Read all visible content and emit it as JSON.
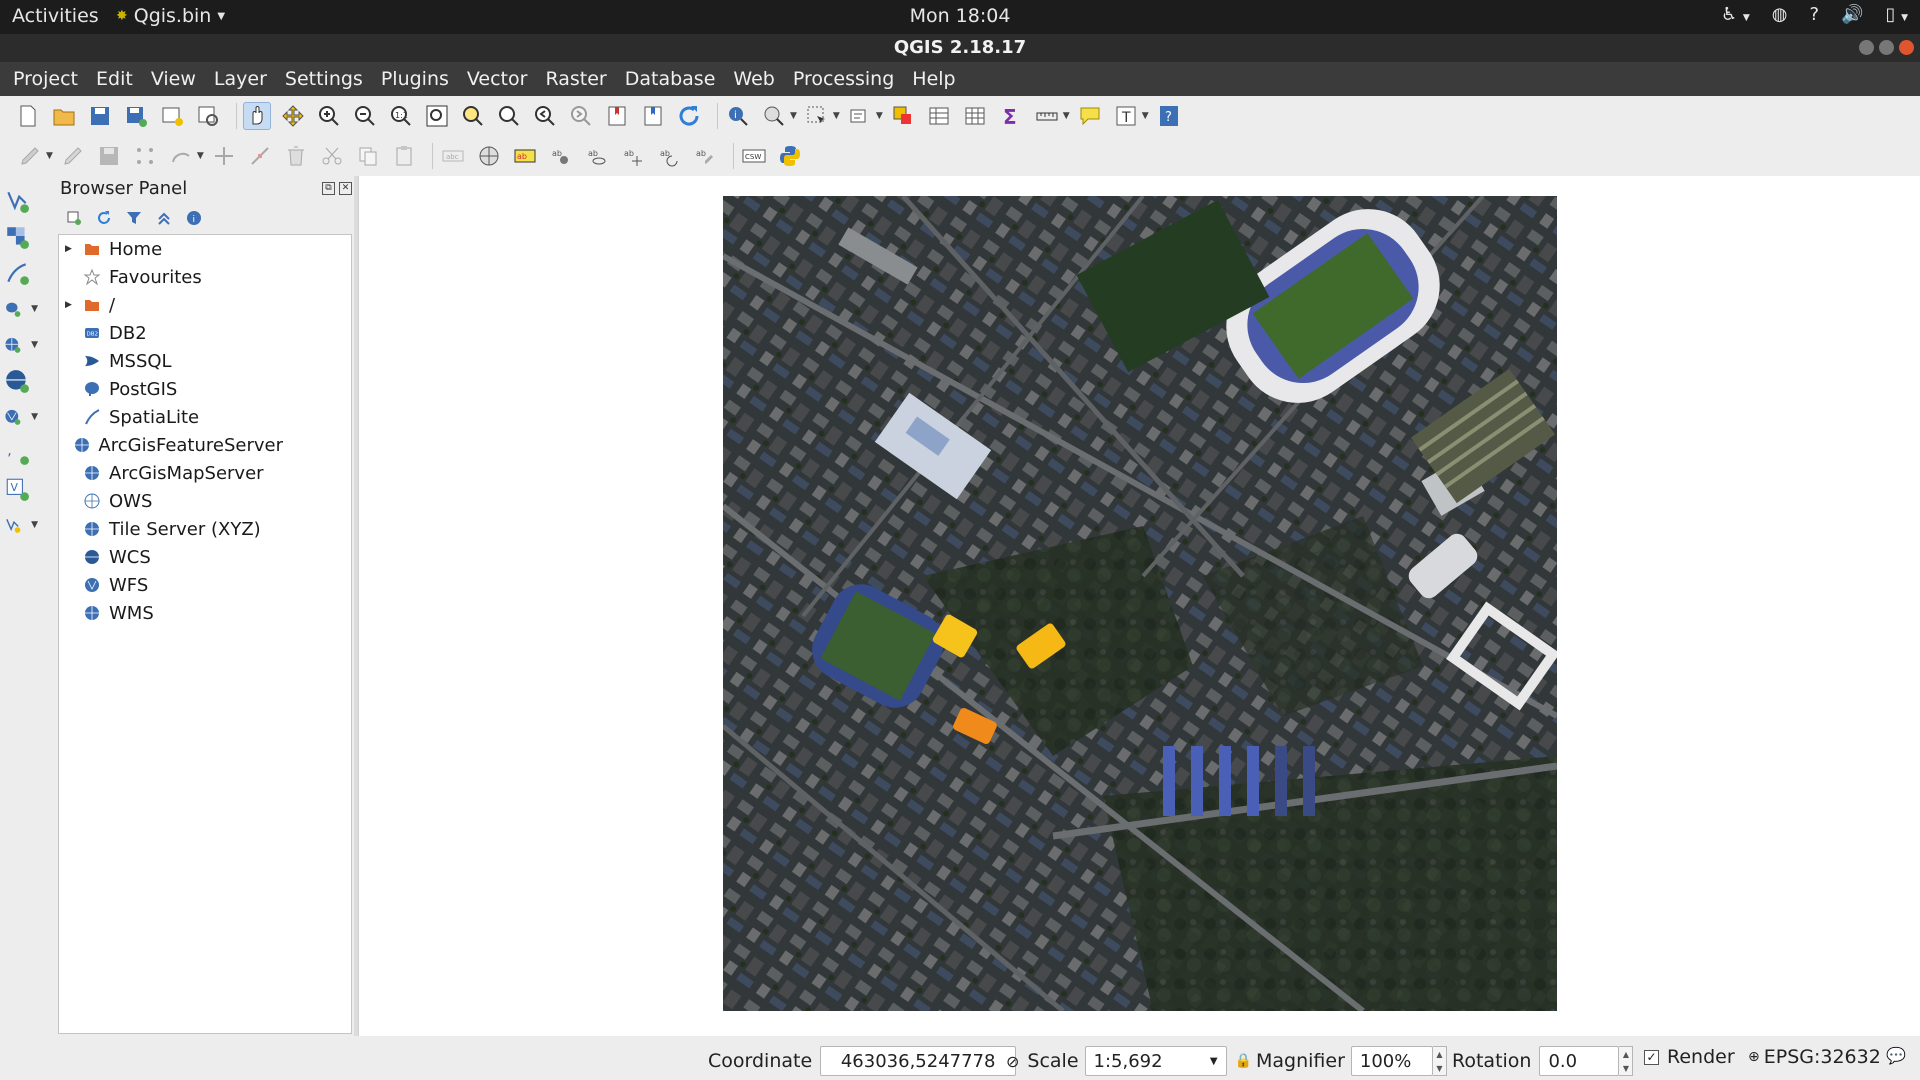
{
  "topbar": {
    "activities": "Activities",
    "app_menu": "Qgis.bin",
    "clock": "Mon 18:04"
  },
  "window": {
    "title": "QGIS 2.18.17"
  },
  "menubar": [
    "Project",
    "Edit",
    "View",
    "Layer",
    "Settings",
    "Plugins",
    "Vector",
    "Raster",
    "Database",
    "Web",
    "Processing",
    "Help"
  ],
  "toolbar2": {
    "csw_label": "CSW"
  },
  "browser": {
    "title": "Browser Panel",
    "items": [
      {
        "label": "Home",
        "icon": "folder-icon",
        "expandable": true
      },
      {
        "label": "Favourites",
        "icon": "star-icon",
        "expandable": false
      },
      {
        "label": "/",
        "icon": "folder-icon",
        "expandable": true
      },
      {
        "label": "DB2",
        "icon": "db2-icon",
        "expandable": false
      },
      {
        "label": "MSSQL",
        "icon": "mssql-icon",
        "expandable": false
      },
      {
        "label": "PostGIS",
        "icon": "postgis-icon",
        "expandable": false
      },
      {
        "label": "SpatiaLite",
        "icon": "spatialite-icon",
        "expandable": false
      },
      {
        "label": "ArcGisFeatureServer",
        "icon": "globe-icon",
        "expandable": false
      },
      {
        "label": "ArcGisMapServer",
        "icon": "globe-icon",
        "expandable": false
      },
      {
        "label": "OWS",
        "icon": "ows-icon",
        "expandable": false
      },
      {
        "label": "Tile Server (XYZ)",
        "icon": "globe-icon",
        "expandable": false
      },
      {
        "label": "WCS",
        "icon": "globe-icon",
        "expandable": false
      },
      {
        "label": "WFS",
        "icon": "globe-icon",
        "expandable": false
      },
      {
        "label": "WMS",
        "icon": "globe-icon",
        "expandable": false
      }
    ]
  },
  "status": {
    "coordinate_label": "Coordinate",
    "coordinate_value": "463036,5247778",
    "scale_label": "Scale",
    "scale_value": "1:5,692",
    "magnifier_label": "Magnifier",
    "magnifier_value": "100%",
    "rotation_label": "Rotation",
    "rotation_value": "0.0",
    "render_label": "Render",
    "render_checked": true,
    "crs": "EPSG:32632"
  },
  "colors": {
    "accent": "#4a90d9",
    "topbar": "#1c1c1c",
    "menubar": "#3b3b3b"
  }
}
